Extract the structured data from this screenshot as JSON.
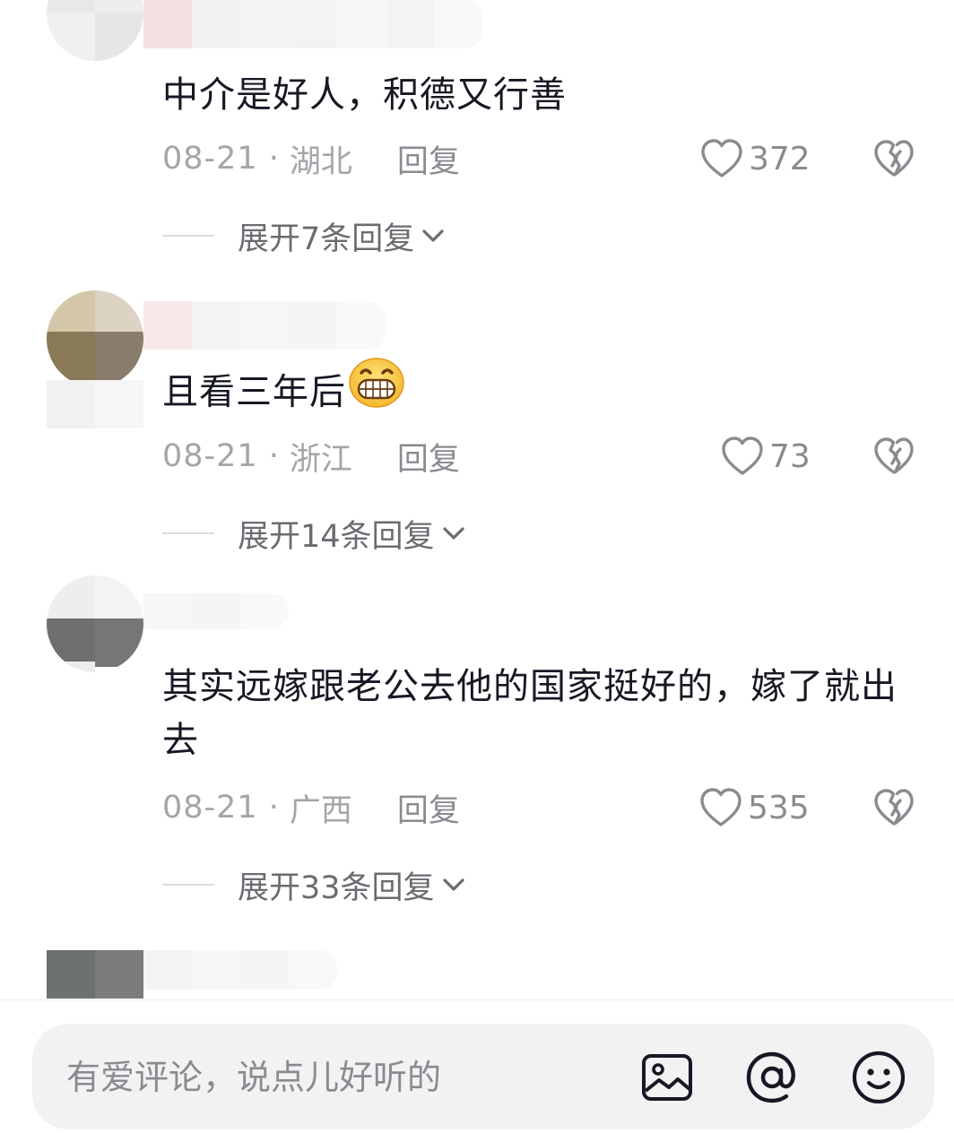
{
  "comments": [
    {
      "text": "中介是好人，积德又行善",
      "date": "08-21",
      "location": "湖北",
      "reply_label": "回复",
      "likes": "372",
      "expand_label": "展开7条回复"
    },
    {
      "text": "且看三年后",
      "emoji": "grinning-face-icon",
      "date": "08-21",
      "location": "浙江",
      "reply_label": "回复",
      "likes": "73",
      "expand_label": "展开14条回复"
    },
    {
      "text": "其实远嫁跟老公去他的国家挺好的，嫁了就出去",
      "date": "08-21",
      "location": "广西",
      "reply_label": "回复",
      "likes": "535",
      "expand_label": "展开33条回复"
    }
  ],
  "meta_separator": "·",
  "input": {
    "placeholder": "有爱评论，说点儿好听的",
    "icons": [
      "image-icon",
      "at-icon",
      "smile-emoji-icon"
    ]
  },
  "colors": {
    "primary_text": "#161823",
    "secondary_text": "#a4a5aa",
    "input_background": "#f2f2f3"
  }
}
